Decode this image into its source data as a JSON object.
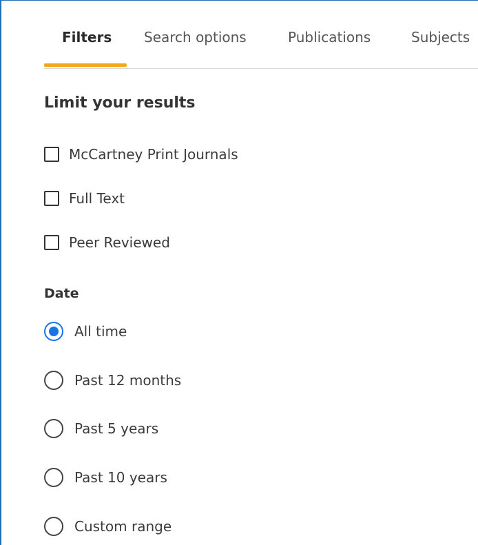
{
  "tabs": [
    {
      "label": "Filters",
      "active": true
    },
    {
      "label": "Search options",
      "active": false
    },
    {
      "label": "Publications",
      "active": false
    },
    {
      "label": "Subjects",
      "active": false
    }
  ],
  "limit": {
    "heading": "Limit your results",
    "options": [
      {
        "label": "McCartney Print Journals",
        "checked": false
      },
      {
        "label": "Full Text",
        "checked": false
      },
      {
        "label": "Peer Reviewed",
        "checked": false
      }
    ]
  },
  "date": {
    "title": "Date",
    "options": [
      {
        "label": "All time",
        "selected": true
      },
      {
        "label": "Past 12 months",
        "selected": false
      },
      {
        "label": "Past 5 years",
        "selected": false
      },
      {
        "label": "Past 10 years",
        "selected": false
      },
      {
        "label": "Custom range",
        "selected": false
      }
    ]
  },
  "colors": {
    "accent_underline": "#f3a81a",
    "radio_selected": "#1a73e8",
    "frame_border": "#1f6fb4"
  }
}
